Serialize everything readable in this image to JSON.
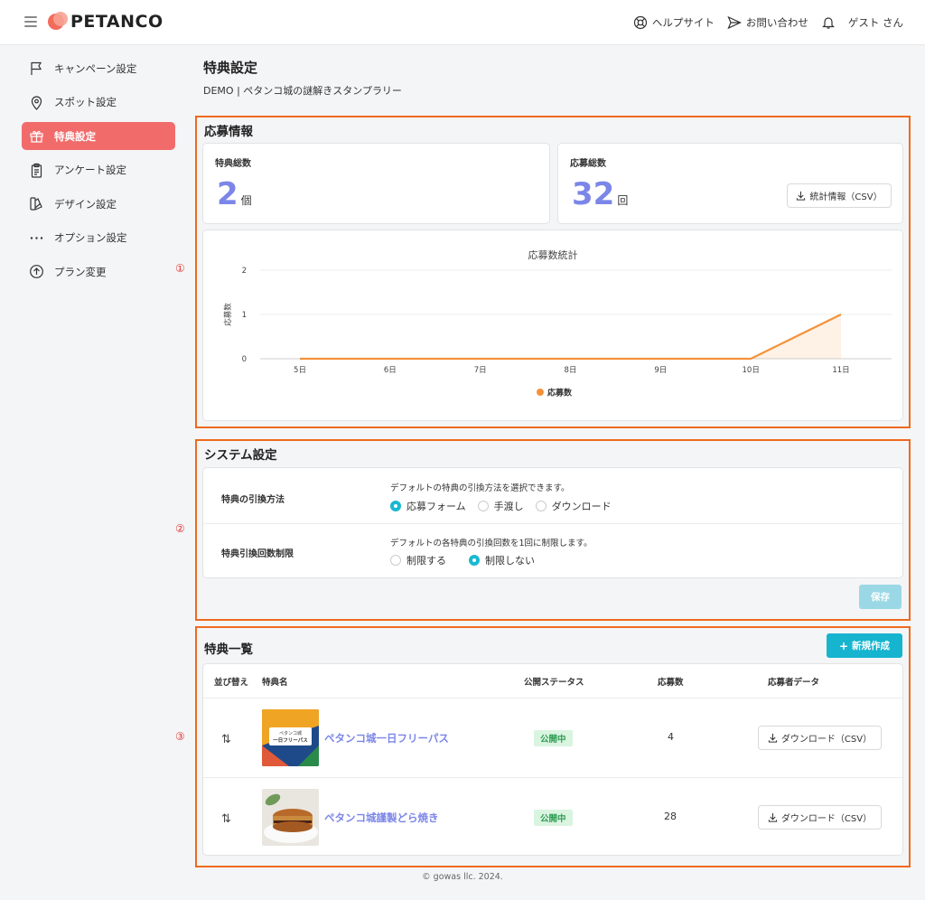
{
  "header": {
    "logo": "PETANCO",
    "help": "ヘルプサイト",
    "contact": "お問い合わせ",
    "user": "ゲスト さん"
  },
  "sidebar": {
    "items": [
      {
        "label": "キャンペーン設定",
        "icon": "flag-icon"
      },
      {
        "label": "スポット設定",
        "icon": "map-pin-icon"
      },
      {
        "label": "特典設定",
        "icon": "gift-icon",
        "active": true
      },
      {
        "label": "アンケート設定",
        "icon": "clipboard-icon"
      },
      {
        "label": "デザイン設定",
        "icon": "palette-icon"
      },
      {
        "label": "オプション設定",
        "icon": "more-icon"
      },
      {
        "label": "プラン変更",
        "icon": "arrow-up-circle-icon"
      }
    ]
  },
  "annotations": [
    "①",
    "②",
    "③"
  ],
  "page": {
    "title": "特典設定",
    "subtitle": "DEMO | ペタンコ城の謎解きスタンプラリー"
  },
  "entry_info": {
    "title": "応募情報",
    "total_rewards_label": "特典総数",
    "total_rewards_value": "2",
    "total_rewards_unit": "個",
    "total_entries_label": "応募総数",
    "total_entries_value": "32",
    "total_entries_unit": "回",
    "csv_button": "統計情報（CSV）"
  },
  "chart_data": {
    "type": "area",
    "title": "応募数統計",
    "xlabel": "",
    "ylabel": "応募数",
    "x": [
      "5日",
      "6日",
      "7日",
      "8日",
      "9日",
      "10日",
      "11日"
    ],
    "series": [
      {
        "name": "応募数",
        "values": [
          0,
          0,
          0,
          0,
          0,
          0,
          1
        ]
      }
    ],
    "ylim": [
      0,
      2
    ],
    "yticks": [
      "0",
      "1",
      "2"
    ],
    "grid": true,
    "legend": "bottom",
    "color": "#f4923a"
  },
  "system": {
    "title": "システム設定",
    "rows": [
      {
        "label": "特典の引換方法",
        "desc": "デフォルトの特典の引換方法を選択できます。",
        "options": [
          {
            "label": "応募フォーム",
            "selected": true
          },
          {
            "label": "手渡し",
            "selected": false
          },
          {
            "label": "ダウンロード",
            "selected": false
          }
        ]
      },
      {
        "label": "特典引換回数制限",
        "desc": "デフォルトの各特典の引換回数を1回に制限します。",
        "options": [
          {
            "label": "制限する",
            "selected": false
          },
          {
            "label": "制限しない",
            "selected": true
          }
        ]
      }
    ],
    "save": "保存"
  },
  "rewards": {
    "title": "特典一覧",
    "new_button": "新規作成",
    "headers": [
      "並び替え",
      "特典名",
      "公開ステータス",
      "応募数",
      "応募者データ"
    ],
    "rows": [
      {
        "name": "ペタンコ城一日フリーパス",
        "status": "公開中",
        "count": "4",
        "download": "ダウンロード（CSV）",
        "thumb_text_1": "ペタンコ城",
        "thumb_text_2": "一日フリーパス"
      },
      {
        "name": "ペタンコ城謹製どら焼き",
        "status": "公開中",
        "count": "28",
        "download": "ダウンロード（CSV）"
      }
    ]
  },
  "footer": "© gowas llc. 2024."
}
